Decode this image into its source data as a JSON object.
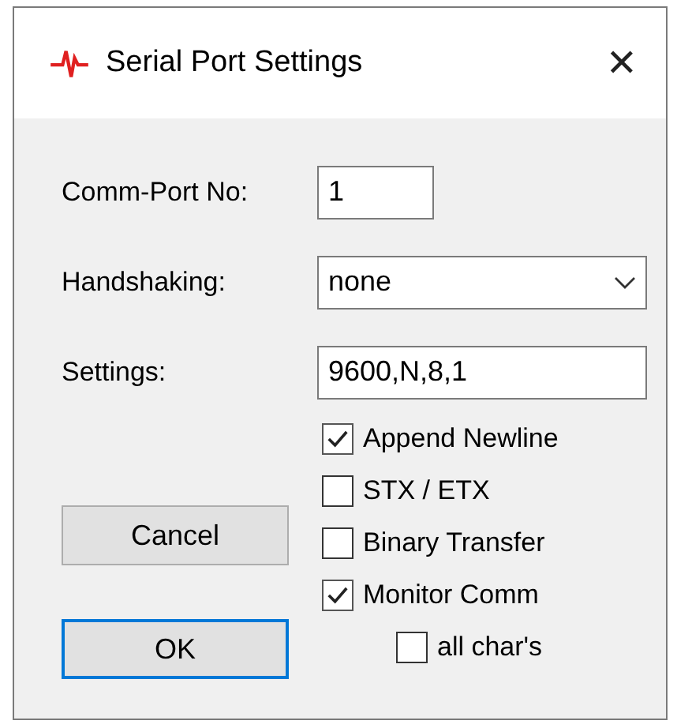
{
  "window": {
    "title": "Serial Port Settings",
    "close": "✕"
  },
  "fields": [
    {
      "kind": "text",
      "label": "Comm-Port No:",
      "value": "1"
    },
    {
      "kind": "dropdown",
      "label": "Handshaking:",
      "value": "none"
    },
    {
      "kind": "text",
      "label": "Settings:",
      "value": "9600,N,8,1"
    }
  ],
  "checkboxes": [
    {
      "label": "Append Newline",
      "checked": true
    },
    {
      "label": "STX / ETX",
      "checked": false
    },
    {
      "label": "Binary Transfer",
      "checked": false
    },
    {
      "label": "Monitor Comm",
      "checked": true,
      "children": [
        {
          "label": "all char's",
          "checked": false
        }
      ]
    }
  ],
  "buttons": [
    {
      "label": "Cancel",
      "default": false
    },
    {
      "label": "OK",
      "default": true
    }
  ]
}
